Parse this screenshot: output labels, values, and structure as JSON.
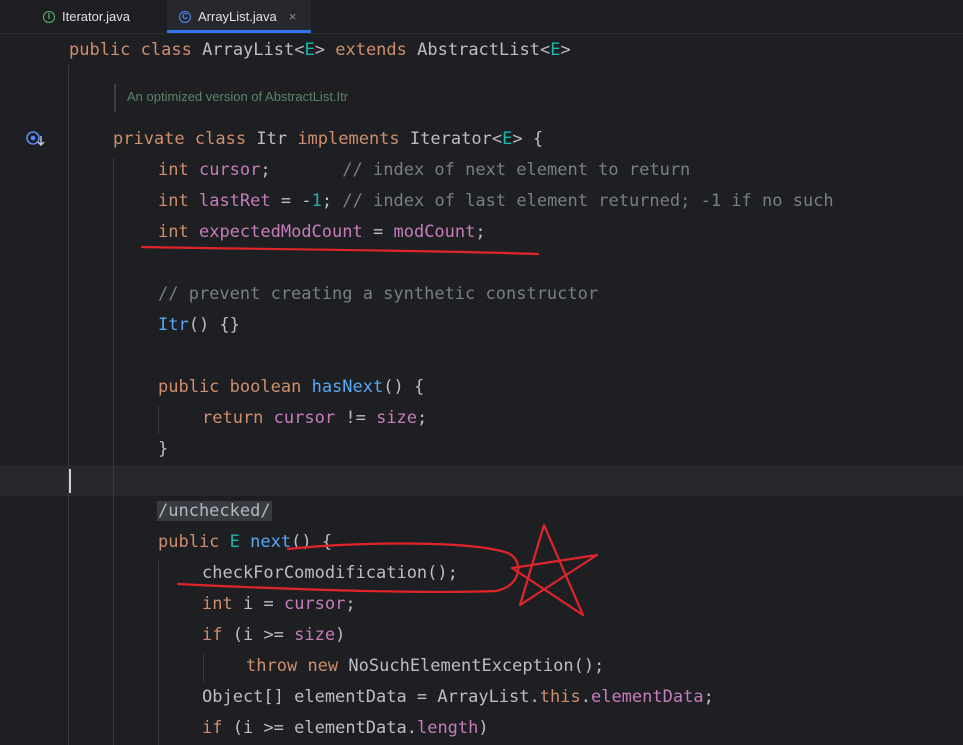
{
  "tabs": [
    {
      "label": "Iterator.java",
      "icon": "interface-icon",
      "icon_glyph": "I",
      "active": false
    },
    {
      "label": "ArrayList.java",
      "icon": "class-icon",
      "icon_glyph": "C",
      "active": true,
      "close_glyph": "×"
    }
  ],
  "doc_comment": "An optimized version of AbstractList.Itr",
  "code": {
    "l0": {
      "kw1": "public",
      "kw2": "class",
      "name": "ArrayList",
      "lt": "<",
      "tp": "E",
      "gt": ">",
      "kw3": "extends",
      "sup": "AbstractList",
      "lt2": "<",
      "tp2": "E",
      "gt2": ">"
    },
    "l1": {
      "kw1": "private",
      "kw2": "class",
      "name": "Itr",
      "kw3": "implements",
      "iface": "Iterator",
      "lt": "<",
      "tp": "E",
      "gt": ">",
      "brace": "{"
    },
    "l2": {
      "typ": "int",
      "fld": "cursor",
      "semi": ";",
      "cmt": "// index of next element to return"
    },
    "l3": {
      "typ": "int",
      "fld": "lastRet",
      "eq": "=",
      "minus": "-",
      "num": "1",
      "semi": ";",
      "cmt": "// index of last element returned; -1 if no such"
    },
    "l4": {
      "typ": "int",
      "fld": "expectedModCount",
      "eq": "=",
      "fld2": "modCount",
      "semi": ";"
    },
    "l5": {
      "cmt": "// prevent creating a synthetic constructor"
    },
    "l6": {
      "fn": "Itr",
      "rest": "() {}"
    },
    "l7": {
      "kw1": "public",
      "kw2": "boolean",
      "fn": "hasNext",
      "rest": "() {"
    },
    "l8": {
      "kw": "return",
      "fld": "cursor",
      "op": "!=",
      "fld2": "size",
      "semi": ";"
    },
    "l9": {
      "brace": "}"
    },
    "l10": {
      "annot": "/unchecked/"
    },
    "l11": {
      "kw": "public",
      "typ": "E",
      "fn": "next",
      "rest": "() {"
    },
    "l12": {
      "call": "checkForComodification",
      "rest": "();"
    },
    "l13": {
      "typ": "int",
      "var": "i",
      "eq": "=",
      "fld": "cursor",
      "semi": ";"
    },
    "l14": {
      "kw": "if",
      "open": "(i >=",
      "fld": "size",
      "close": ")"
    },
    "l15": {
      "kw1": "throw",
      "kw2": "new",
      "cls": "NoSuchElementException",
      "rest": "();"
    },
    "l16": {
      "head": "Object[] elementData = ArrayList.",
      "kw": "this",
      "dot": ".",
      "fld": "elementData",
      "semi": ";"
    },
    "l17": {
      "kw": "if",
      "open": "(i >= elementData.",
      "fld": "length",
      "close": ")"
    }
  },
  "gutter": {
    "icon": "implements-gutter-icon"
  },
  "annotations": {
    "color": "#e0242b",
    "marks": [
      "underline-expectedModCount",
      "loop-checkForComodification",
      "star"
    ]
  },
  "colors": {
    "keyword": "#cf8e6d",
    "field": "#c77dbb",
    "function": "#56a8f5",
    "comment": "#7a7e85",
    "number": "#2aacb8",
    "type_param": "#16baac",
    "accent": "#3574f0"
  }
}
